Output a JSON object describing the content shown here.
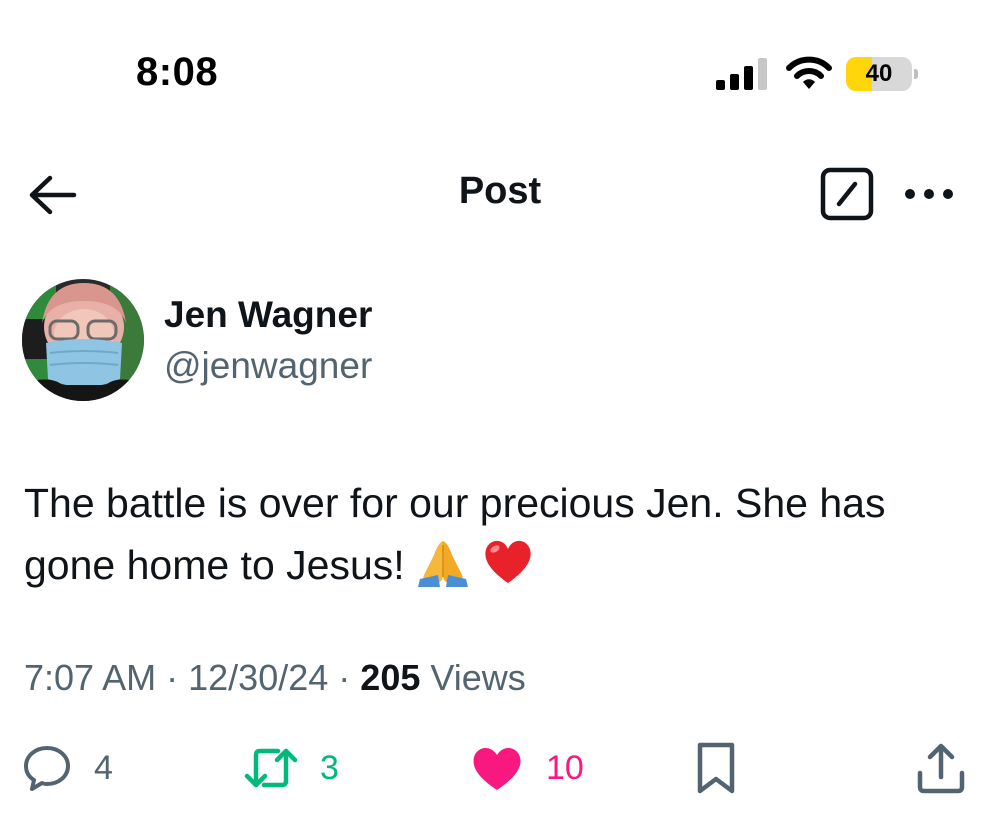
{
  "status_bar": {
    "time": "8:08",
    "battery_percent": "40",
    "battery_level": 0.4,
    "icons": [
      "cellular-signal-icon",
      "wifi-icon",
      "battery-icon"
    ]
  },
  "nav": {
    "title": "Post",
    "icons": [
      "back-arrow-icon",
      "edit-icon",
      "more-icon"
    ]
  },
  "post": {
    "author": {
      "name": "Jen Wagner",
      "handle": "@jenwagner"
    },
    "text_line1": "The battle is over for our precious Jen. She has",
    "text_line2": "gone home to Jesus!",
    "emojis": [
      "folded-hands",
      "red-heart"
    ],
    "time": "7:07 AM",
    "date": "12/30/24",
    "views_count": "205",
    "views_label": "Views",
    "separator": "·"
  },
  "actions": {
    "replies": "4",
    "reposts": "3",
    "likes": "10",
    "liked": true,
    "icons": [
      "reply-icon",
      "repost-icon",
      "heart-icon",
      "bookmark-icon",
      "share-icon"
    ]
  },
  "colors": {
    "text_primary": "#0f1419",
    "text_secondary": "#536471",
    "repost_green": "#00ba7c",
    "like_pink": "#f91880",
    "battery_yellow": "#ffd60a"
  }
}
